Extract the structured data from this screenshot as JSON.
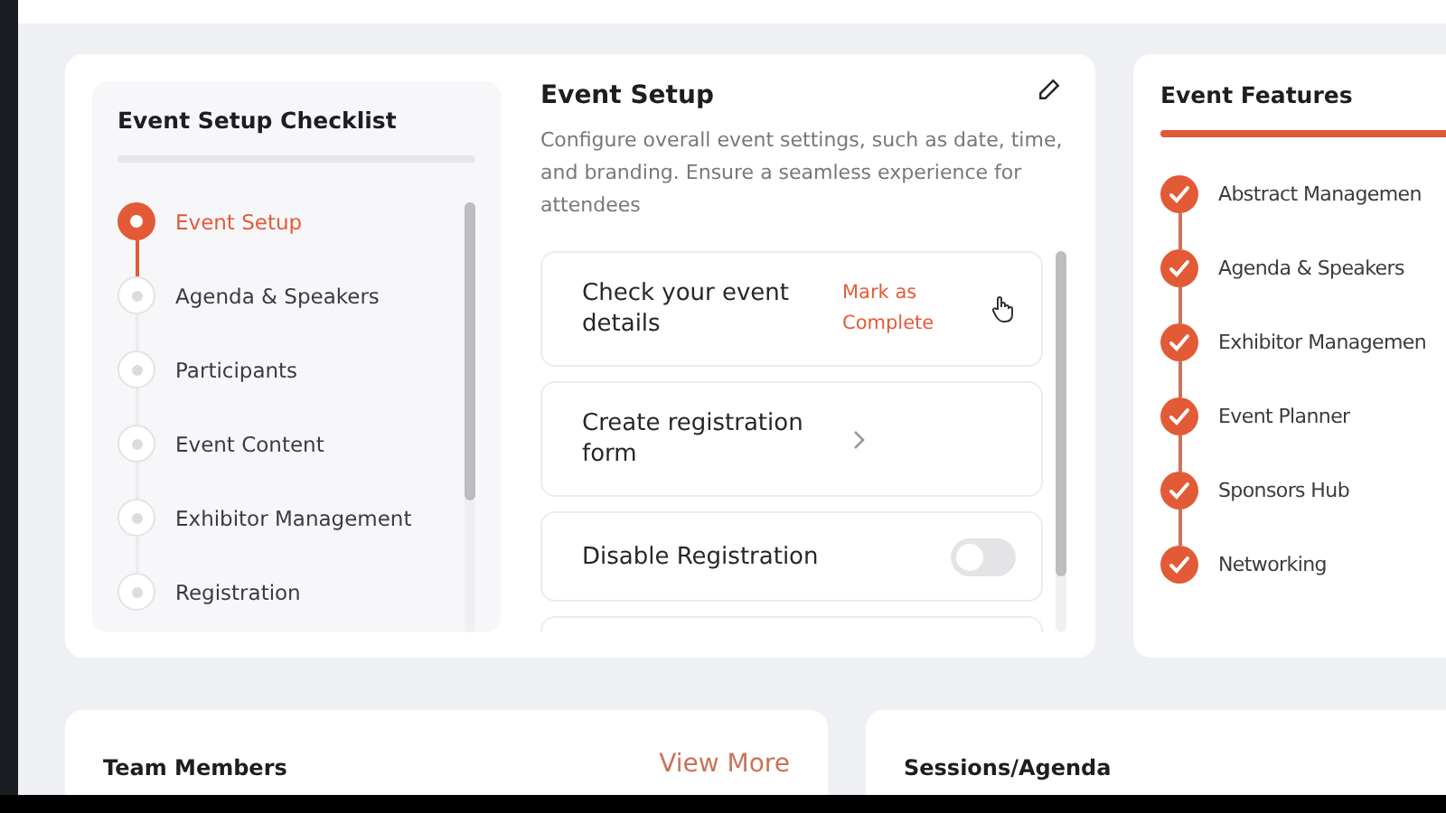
{
  "checklist": {
    "title": "Event Setup Checklist",
    "items": [
      {
        "label": "Event Setup",
        "selected": true
      },
      {
        "label": "Agenda & Speakers",
        "selected": false
      },
      {
        "label": "Participants",
        "selected": false
      },
      {
        "label": "Event Content",
        "selected": false
      },
      {
        "label": "Exhibitor Management",
        "selected": false
      },
      {
        "label": "Registration",
        "selected": false
      }
    ]
  },
  "setup": {
    "title": "Event Setup",
    "description": "Configure overall event settings, such as date, time, and branding. Ensure a seamless experience for attendees",
    "tasks": [
      {
        "kind": "action",
        "label": "Check your event details",
        "action": "Mark as Complete"
      },
      {
        "kind": "link",
        "label": "Create registration form"
      },
      {
        "kind": "toggle",
        "label": "Disable Registration",
        "on": false
      }
    ]
  },
  "features": {
    "title": "Event Features",
    "items": [
      {
        "label": "Abstract Managemen",
        "checked": true
      },
      {
        "label": "Agenda & Speakers",
        "checked": true
      },
      {
        "label": "Exhibitor Managemen",
        "checked": true
      },
      {
        "label": "Event Planner",
        "checked": true
      },
      {
        "label": "Sponsors Hub",
        "checked": true
      },
      {
        "label": "Networking",
        "checked": true
      }
    ]
  },
  "team": {
    "title": "Team Members",
    "link": "View More"
  },
  "sessions": {
    "title": "Sessions/Agenda"
  }
}
